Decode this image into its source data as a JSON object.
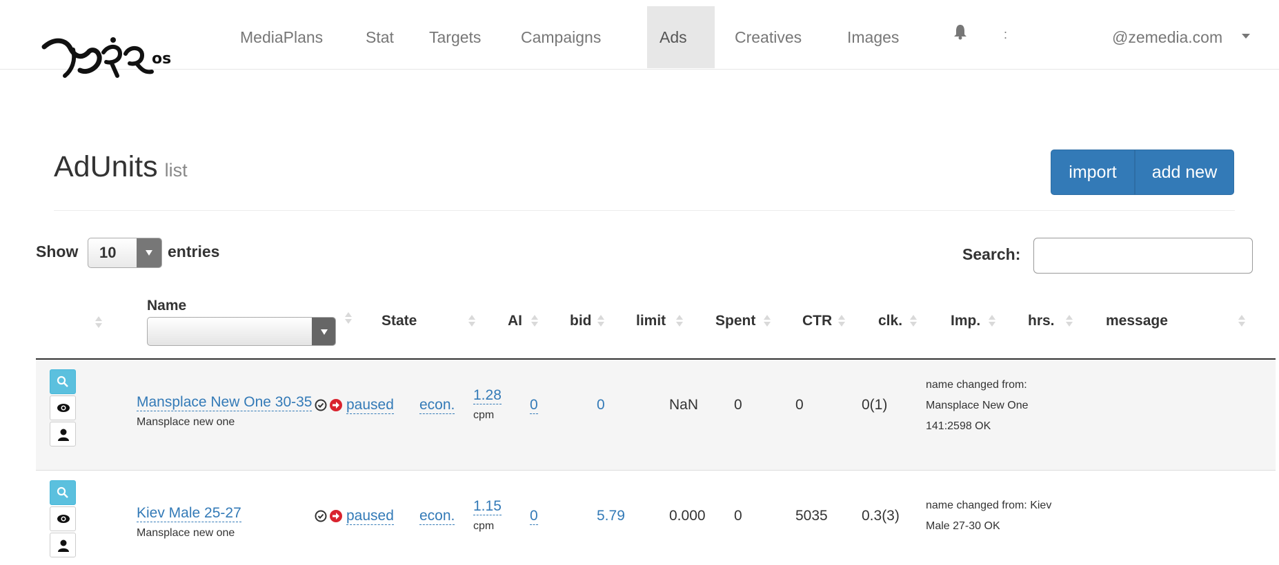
{
  "brand": {
    "logo_text": "NaRos"
  },
  "nav": {
    "items": [
      {
        "label": "MediaPlans"
      },
      {
        "label": "Stat"
      },
      {
        "label": "Targets"
      },
      {
        "label": "Campaigns"
      },
      {
        "label": "Ads",
        "active": true
      },
      {
        "label": "Creatives"
      },
      {
        "label": "Images"
      }
    ],
    "notification_icon": "bell-icon",
    "user_email_visible": "@zemedia.com",
    "user_prefix": ":"
  },
  "page": {
    "title": "AdUnits",
    "subtitle": "list"
  },
  "actions": {
    "import_label": "import",
    "add_label": "add new"
  },
  "controls": {
    "show_label": "Show",
    "entries_value": "10",
    "entries_label": "entries",
    "search_label": "Search:",
    "search_value": ""
  },
  "table": {
    "columns": [
      "Name",
      "State",
      "AI",
      "bid",
      "limit",
      "Spent",
      "CTR",
      "clk.",
      "Imp.",
      "hrs.",
      "message"
    ],
    "rows": [
      {
        "name": "Mansplace New One 30-35",
        "campaign": "Mansplace new one",
        "state": "paused",
        "ai": "econ.",
        "bid": "1.28",
        "bid_unit": "cpm",
        "limit": "0",
        "spent": "0",
        "ctr": "NaN",
        "clicks": "0",
        "impressions": "0",
        "hours": "0(1)",
        "message": [
          "name changed from:",
          "Mansplace New One",
          "141:2598 OK"
        ]
      },
      {
        "name": "Kiev Male 25-27",
        "campaign": "Mansplace new one",
        "state": "paused",
        "ai": "econ.",
        "bid": "1.15",
        "bid_unit": "cpm",
        "limit": "0",
        "spent": "5.79",
        "ctr": "0.000",
        "clicks": "0",
        "impressions": "5035",
        "hours": "0.3(3)",
        "message": [
          "name changed from: Kiev",
          "Male 27-30 OK"
        ]
      }
    ]
  },
  "colors": {
    "primary": "#337ab7",
    "info": "#5bc0de",
    "danger": "#d9232e"
  }
}
